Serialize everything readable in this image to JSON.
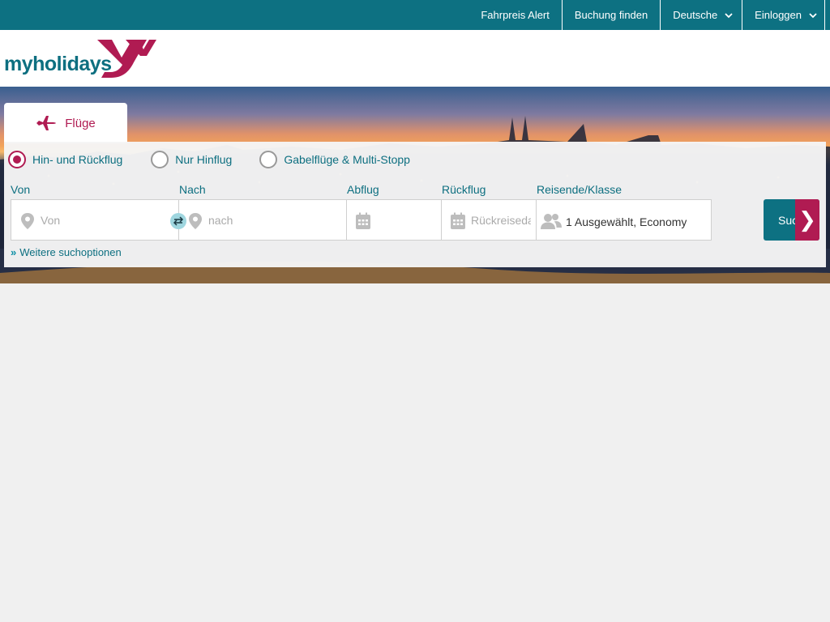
{
  "topnav": {
    "items": [
      {
        "label": "Fahrpreis Alert"
      },
      {
        "label": "Buchung finden"
      },
      {
        "label": "Deutsche"
      },
      {
        "label": "Einloggen"
      }
    ]
  },
  "brand": {
    "logo_text": "myholidays",
    "colors": {
      "primary": "#0d7182",
      "accent": "#b01b52"
    }
  },
  "tab": {
    "label": "Flüge",
    "icon": "plane-icon"
  },
  "trip_type": {
    "options": [
      {
        "label": "Hin- und Rückflug",
        "checked": true
      },
      {
        "label": "Nur Hinflug",
        "checked": false
      },
      {
        "label": "Gabelflüge & Multi-Stopp",
        "checked": false
      }
    ]
  },
  "fields": {
    "from": {
      "label": "Von",
      "placeholder": "Von"
    },
    "to": {
      "label": "Nach",
      "placeholder": "nach"
    },
    "depart": {
      "label": "Abflug",
      "placeholder": ""
    },
    "return": {
      "label": "Rückflug",
      "placeholder": "Rückreisedatum"
    },
    "travellers": {
      "label": "Reisende/Klasse",
      "value": "1 Ausgewählt, Economy"
    }
  },
  "search_button": {
    "label": "Suchen"
  },
  "more_options": {
    "label": "Weitere suchoptionen"
  }
}
